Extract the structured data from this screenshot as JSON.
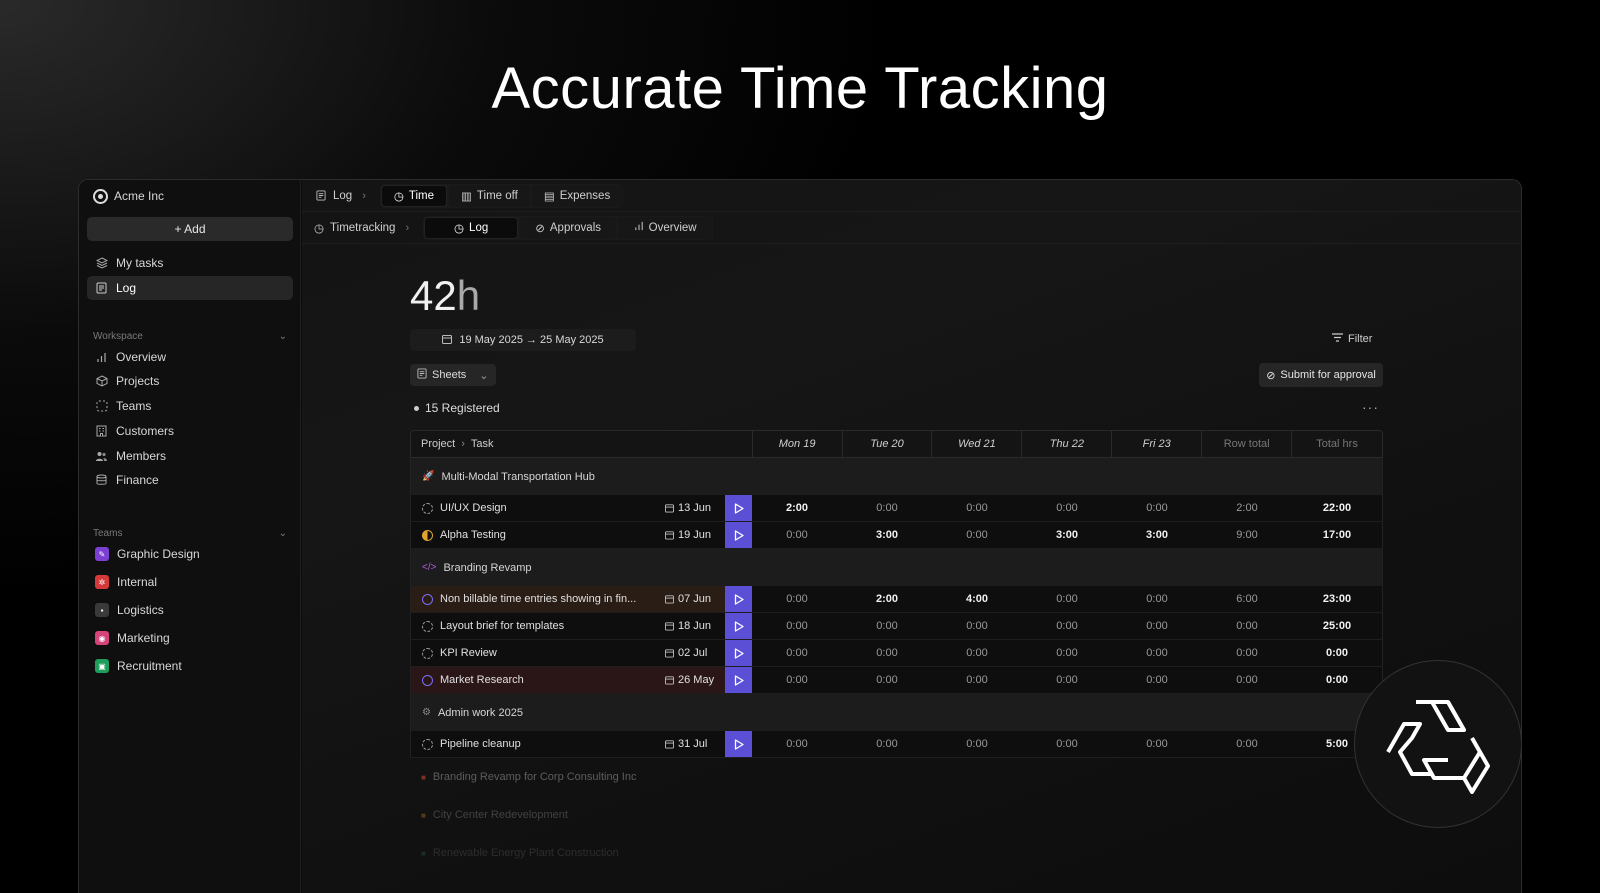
{
  "hero": {
    "title": "Accurate Time Tracking"
  },
  "sidebar": {
    "org": "Acme Inc",
    "add_label": "+ Add",
    "top_items": [
      {
        "label": "My tasks",
        "icon": "layers-icon"
      },
      {
        "label": "Log",
        "icon": "log-icon",
        "active": true
      }
    ],
    "workspace_label": "Workspace",
    "workspace_items": [
      {
        "label": "Overview",
        "icon": "bar-chart-icon"
      },
      {
        "label": "Projects",
        "icon": "box-icon"
      },
      {
        "label": "Teams",
        "icon": "dashed-square-icon"
      },
      {
        "label": "Customers",
        "icon": "building-icon"
      },
      {
        "label": "Members",
        "icon": "users-icon"
      },
      {
        "label": "Finance",
        "icon": "database-icon"
      }
    ],
    "teams_label": "Teams",
    "teams": [
      {
        "label": "Graphic Design",
        "color": "#7b3fd1"
      },
      {
        "label": "Internal",
        "color": "#d43a3a"
      },
      {
        "label": "Logistics",
        "color": "#444444"
      },
      {
        "label": "Marketing",
        "color": "#d6427a"
      },
      {
        "label": "Recruitment",
        "color": "#1f9e5b"
      }
    ]
  },
  "tabs1": {
    "crumb": "Log",
    "tabs": [
      {
        "label": "Time",
        "active": true
      },
      {
        "label": "Time off"
      },
      {
        "label": "Expenses"
      }
    ]
  },
  "tabs2": {
    "crumb": "Timetracking",
    "tabs": [
      {
        "label": "Log",
        "active": true
      },
      {
        "label": "Approvals"
      },
      {
        "label": "Overview"
      }
    ]
  },
  "summary": {
    "hours_num": "42",
    "hours_unit": "h",
    "range": "19 May 2025 → 25 May 2025",
    "filter": "Filter",
    "sheets": "Sheets",
    "submit": "Submit for approval",
    "registered": "15 Registered"
  },
  "table": {
    "head_project": "Project",
    "head_task": "Task",
    "days": [
      "Mon 19",
      "Tue 20",
      "Wed 21",
      "Thu 22",
      "Fri 23"
    ],
    "row_total": "Row total",
    "total_hrs": "Total hrs",
    "groups": [
      {
        "name": "Multi-Modal Transportation Hub",
        "icon": "rocket-icon",
        "rows": [
          {
            "title": "UI/UX Design",
            "due": "13 Jun",
            "status": "dashed",
            "values": [
              "2:00",
              "0:00",
              "0:00",
              "0:00",
              "0:00"
            ],
            "bold": [
              true,
              false,
              false,
              false,
              false
            ],
            "row_total": "2:00",
            "total": "22:00"
          },
          {
            "title": "Alpha Testing",
            "due": "19 Jun",
            "status": "half",
            "values": [
              "0:00",
              "3:00",
              "0:00",
              "3:00",
              "3:00"
            ],
            "bold": [
              false,
              true,
              false,
              true,
              true
            ],
            "row_total": "9:00",
            "total": "17:00"
          }
        ]
      },
      {
        "name": "Branding Revamp",
        "icon": "code-icon",
        "rows": [
          {
            "title": "Non billable time entries showing in fin...",
            "due": "07 Jun",
            "status": "ring",
            "highlight": "brown",
            "values": [
              "0:00",
              "2:00",
              "4:00",
              "0:00",
              "0:00"
            ],
            "bold": [
              false,
              true,
              true,
              false,
              false
            ],
            "row_total": "6:00",
            "total": "23:00"
          },
          {
            "title": "Layout brief for templates",
            "due": "18 Jun",
            "status": "dashed",
            "values": [
              "0:00",
              "0:00",
              "0:00",
              "0:00",
              "0:00"
            ],
            "bold": [
              false,
              false,
              false,
              false,
              false
            ],
            "row_total": "0:00",
            "total": "25:00"
          },
          {
            "title": "KPI Review",
            "due": "02 Jul",
            "status": "dashed",
            "values": [
              "0:00",
              "0:00",
              "0:00",
              "0:00",
              "0:00"
            ],
            "bold": [
              false,
              false,
              false,
              false,
              false
            ],
            "row_total": "0:00",
            "total": "0:00"
          },
          {
            "title": "Market Research",
            "due": "26 May",
            "status": "ring",
            "highlight": "red",
            "values": [
              "0:00",
              "0:00",
              "0:00",
              "0:00",
              "0:00"
            ],
            "bold": [
              false,
              false,
              false,
              false,
              false
            ],
            "row_total": "0:00",
            "total": "0:00"
          }
        ]
      },
      {
        "name": "Admin work 2025",
        "icon": "gear-icon",
        "rows": [
          {
            "title": "Pipeline cleanup",
            "due": "31 Jul",
            "status": "dashed",
            "values": [
              "0:00",
              "0:00",
              "0:00",
              "0:00",
              "0:00"
            ],
            "bold": [
              false,
              false,
              false,
              false,
              false
            ],
            "row_total": "0:00",
            "total": "5:00"
          }
        ]
      }
    ],
    "faded_groups": [
      {
        "name": "Branding Revamp for Corp Consulting Inc",
        "color": "#d24a3a"
      },
      {
        "name": "City Center Redevelopment",
        "color": "#c98a2a"
      },
      {
        "name": "Renewable Energy Plant Construction",
        "color": "#3aa86b"
      }
    ]
  },
  "badge": {
    "icon": "recycle-logo-icon"
  }
}
